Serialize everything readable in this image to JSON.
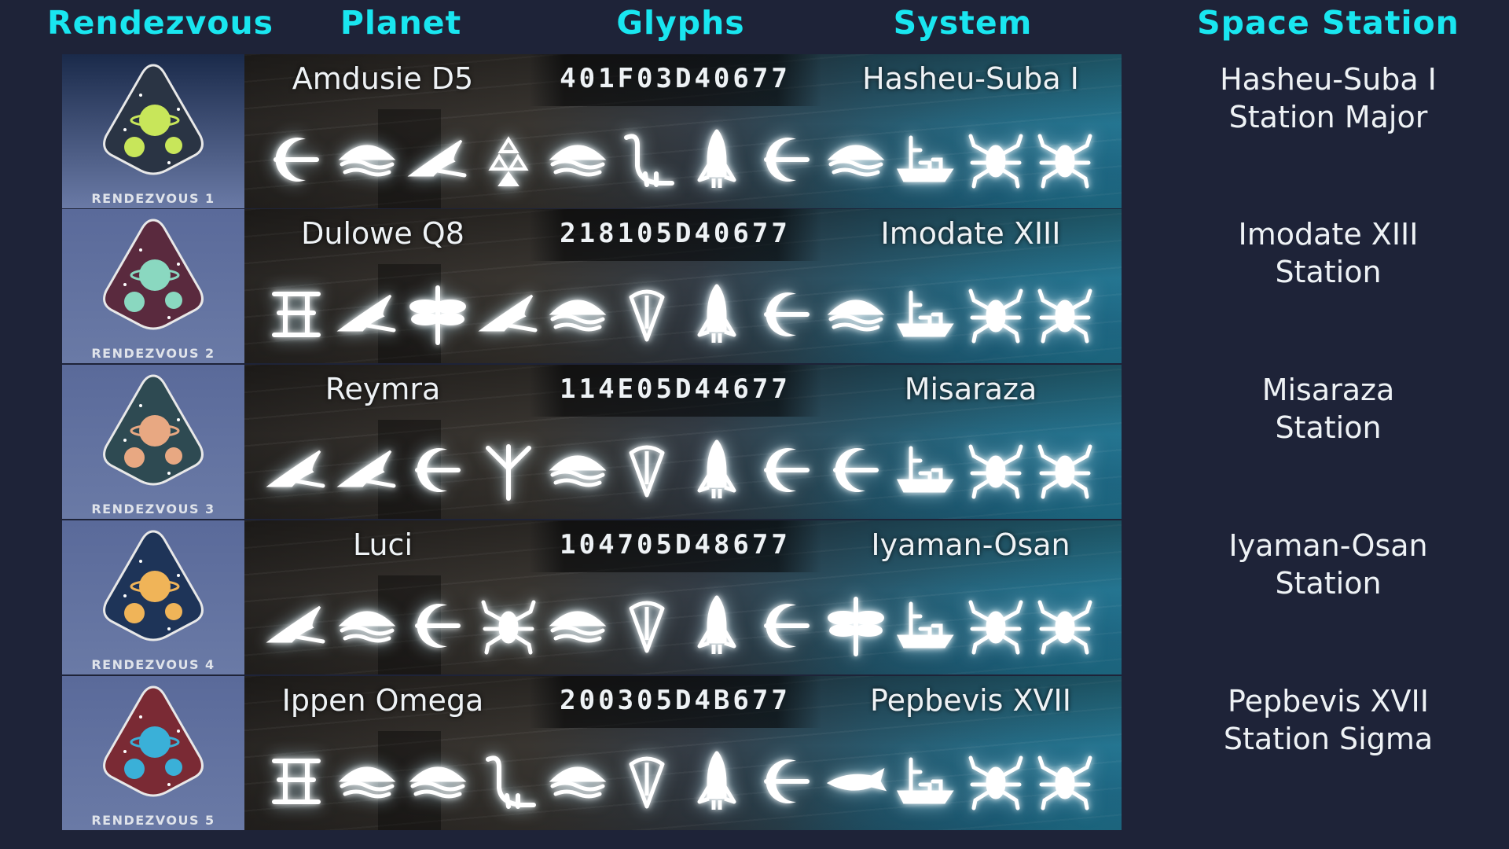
{
  "headers": {
    "rendezvous": "Rendezvous",
    "planet": "Planet",
    "glyphs": "Glyphs",
    "system": "System",
    "space_station": "Space Station"
  },
  "rows": [
    {
      "emblem_label": "RENDEZVOUS 1",
      "emblem_colors": {
        "bg": "#1a2a4a",
        "triangle": "#2a3444",
        "planet": "#c8e65a"
      },
      "planet": "Amdusie D5",
      "code": "401F03D40677",
      "system": "Hasheu-Suba I",
      "station_line1": "Hasheu-Suba I",
      "station_line2": "Station Major",
      "glyph_icons": [
        "eclipse",
        "boat",
        "bird",
        "triangle",
        "boat",
        "dinosaur",
        "rocket",
        "eclipse",
        "boat",
        "ship",
        "bug",
        "bug"
      ]
    },
    {
      "emblem_label": "RENDEZVOUS 2",
      "emblem_colors": {
        "bg": "#5a6a9a",
        "triangle": "#5a2a3e",
        "planet": "#8ad8c0"
      },
      "planet": "Dulowe Q8",
      "code": "218105D40677",
      "system": "Imodate XIII",
      "station_line1": "Imodate XIII",
      "station_line2": "Station",
      "glyph_icons": [
        "portal",
        "bird",
        "dragonfly",
        "bird",
        "boat",
        "drop",
        "rocket",
        "eclipse",
        "boat",
        "ship",
        "bug",
        "bug"
      ]
    },
    {
      "emblem_label": "RENDEZVOUS 3",
      "emblem_colors": {
        "bg": "#5a6a9a",
        "triangle": "#2e4a52",
        "planet": "#e8a882"
      },
      "planet": "Reymra",
      "code": "114E05D44677",
      "system": "Misaraza",
      "station_line1": "Misaraza",
      "station_line2": "Station",
      "glyph_icons": [
        "bird",
        "bird",
        "eclipse",
        "tree",
        "boat",
        "drop",
        "rocket",
        "eclipse",
        "eclipse",
        "ship",
        "bug",
        "bug"
      ]
    },
    {
      "emblem_label": "RENDEZVOUS 4",
      "emblem_colors": {
        "bg": "#5a6a9a",
        "triangle": "#1e3458",
        "planet": "#f0b458"
      },
      "planet": "Luci",
      "code": "104705D48677",
      "system": "Iyaman-Osan",
      "station_line1": "Iyaman-Osan",
      "station_line2": "Station",
      "glyph_icons": [
        "bird",
        "boat",
        "eclipse",
        "bug",
        "boat",
        "drop",
        "rocket",
        "eclipse",
        "dragonfly",
        "ship",
        "bug",
        "bug"
      ]
    },
    {
      "emblem_label": "RENDEZVOUS 5",
      "emblem_colors": {
        "bg": "#5a6a9a",
        "triangle": "#7a2a34",
        "planet": "#3ab0d8"
      },
      "planet": "Ippen Omega",
      "code": "200305D4B677",
      "system": "Pepbevis XVII",
      "station_line1": "Pepbevis XVII",
      "station_line2": "Station Sigma",
      "glyph_icons": [
        "portal",
        "boat",
        "boat",
        "dinosaur",
        "boat",
        "drop",
        "rocket",
        "eclipse",
        "whale",
        "ship",
        "bug",
        "bug"
      ]
    }
  ]
}
